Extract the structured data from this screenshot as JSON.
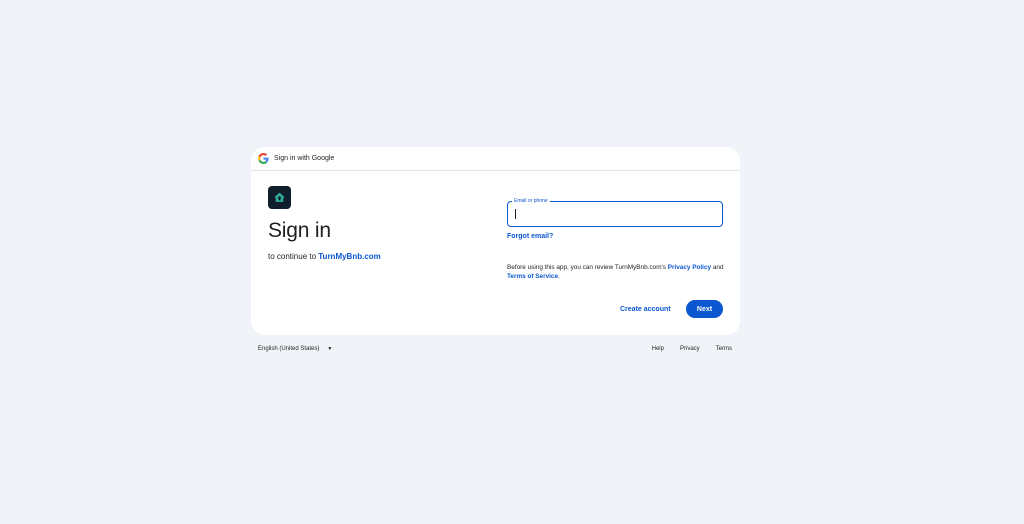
{
  "header": {
    "title": "Sign in with Google"
  },
  "main": {
    "title": "Sign in",
    "subtitle_prefix": "to continue to ",
    "app_link": "TurnMyBnb.com",
    "email_field": {
      "label": "Email or phone",
      "value": ""
    },
    "forgot_email": "Forgot email?",
    "notice": {
      "text1": "Before using this app, you can review TurnMyBnb.com's ",
      "privacy_link": "Privacy Policy",
      "text2": " and ",
      "terms_link": "Terms of Service",
      "text3": "."
    },
    "create_account": "Create account",
    "next": "Next"
  },
  "footer": {
    "language": "English (United States)",
    "links": [
      "Help",
      "Privacy",
      "Terms"
    ]
  },
  "colors": {
    "accent": "#0b57d0",
    "background": "#f0f4f9"
  },
  "icons": {
    "google": "google-g-icon",
    "app": "house-icon",
    "dropdown": "caret-down-icon"
  }
}
